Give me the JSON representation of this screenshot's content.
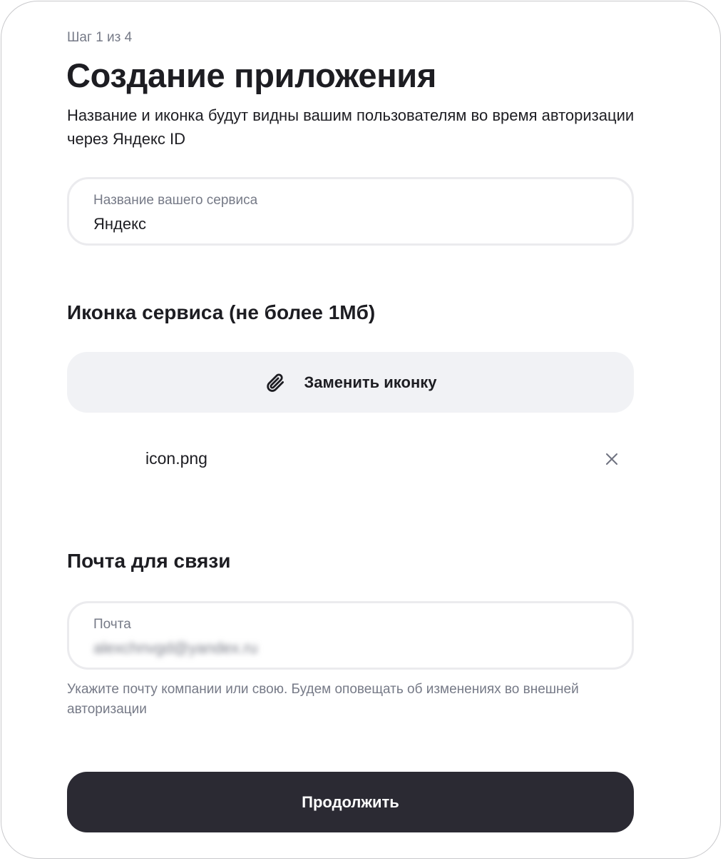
{
  "header": {
    "step": "Шаг 1 из 4",
    "title": "Создание приложения",
    "subtitle": "Название и иконка будут видны вашим пользователям во время авторизации через Яндекс ID"
  },
  "service_name": {
    "label": "Название вашего сервиса",
    "value": "Яндекс"
  },
  "icon_section": {
    "title": "Иконка сервиса (не более 1Мб)",
    "replace_button": "Заменить иконку",
    "button_icon": "paperclip-icon",
    "file_name": "icon.png",
    "remove_icon": "close-icon"
  },
  "email_section": {
    "title": "Почта для связи",
    "label": "Почта",
    "value": "alexchnvgd@yandex.ru",
    "hint": "Укажите почту компании или свою. Будем оповещать об изменениях во внешней авторизации"
  },
  "footer": {
    "continue_button": "Продолжить"
  },
  "colors": {
    "text": "#1d1d22",
    "muted": "#767a87",
    "field_border": "#ebebee",
    "secondary_button": "#f1f2f5",
    "primary_button": "#2b2a33"
  }
}
